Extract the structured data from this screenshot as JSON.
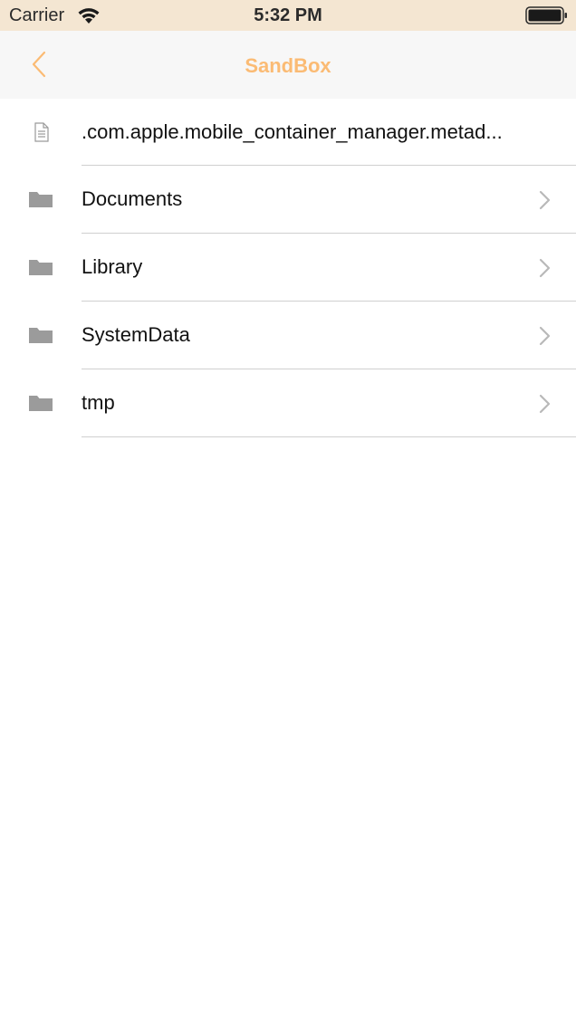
{
  "status_bar": {
    "carrier": "Carrier",
    "time": "5:32 PM",
    "wifi_icon": "wifi-icon",
    "battery_icon": "battery-icon",
    "background_color": "#f4e6d2"
  },
  "nav_bar": {
    "title": "SandBox",
    "back_icon": "chevron-left-icon",
    "accent_color": "#fbbb74"
  },
  "files": [
    {
      "name": ".com.apple.mobile_container_manager.metad...",
      "type": "file",
      "icon": "document-icon",
      "has_chevron": false
    },
    {
      "name": "Documents",
      "type": "folder",
      "icon": "folder-icon",
      "has_chevron": true
    },
    {
      "name": "Library",
      "type": "folder",
      "icon": "folder-icon",
      "has_chevron": true
    },
    {
      "name": "SystemData",
      "type": "folder",
      "icon": "folder-icon",
      "has_chevron": true
    },
    {
      "name": "tmp",
      "type": "folder",
      "icon": "folder-icon",
      "has_chevron": true
    }
  ]
}
